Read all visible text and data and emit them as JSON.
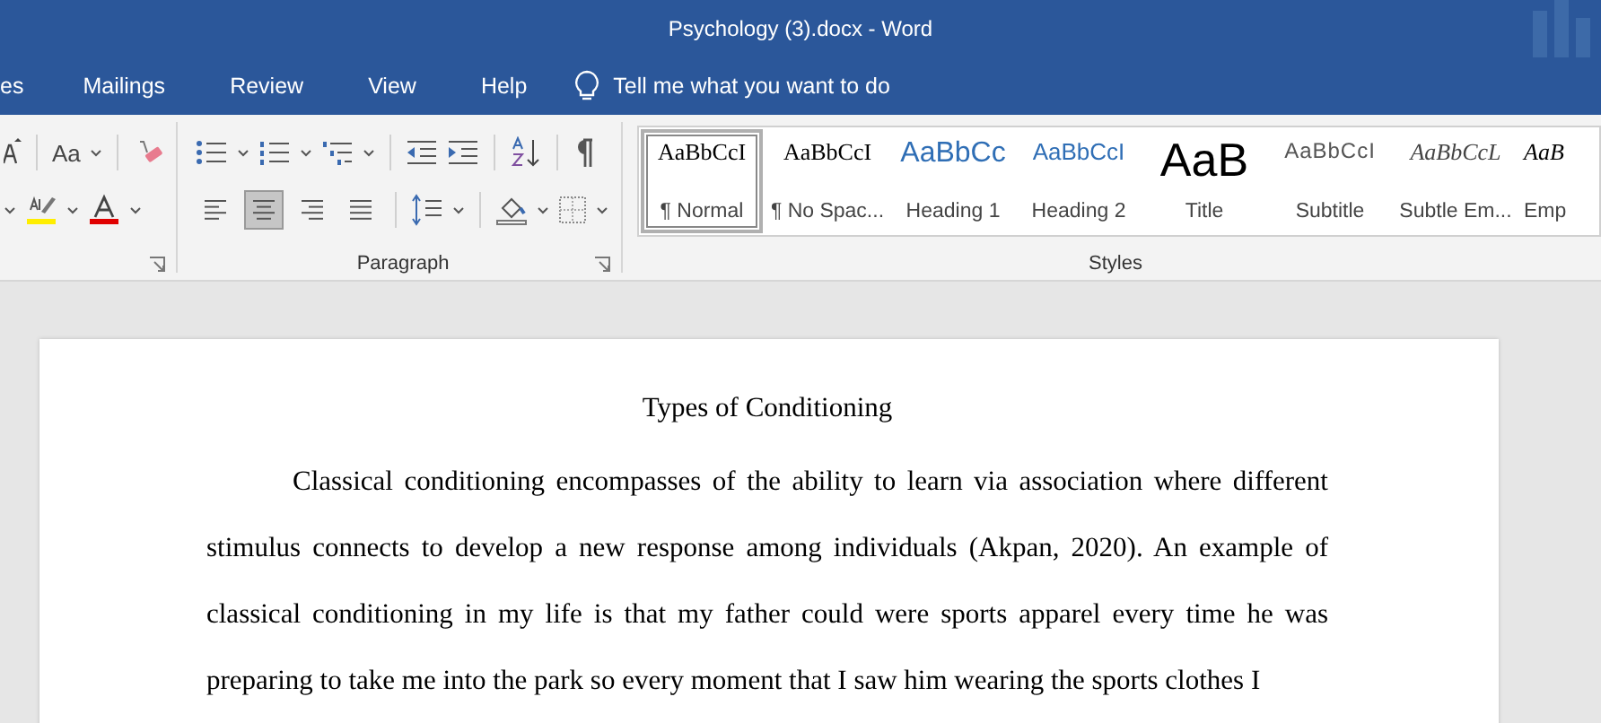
{
  "window": {
    "title": "Psychology (3).docx  -  Word"
  },
  "tabs": [
    {
      "label": "es"
    },
    {
      "label": "Mailings"
    },
    {
      "label": "Review"
    },
    {
      "label": "View"
    },
    {
      "label": "Help"
    }
  ],
  "tell_me": {
    "placeholder": "Tell me what you want to do"
  },
  "ribbon": {
    "font_group": {
      "change_case": "Aa"
    },
    "paragraph_group": {
      "label": "Paragraph",
      "alignment": [
        {
          "kind": "left",
          "selected": false
        },
        {
          "kind": "center",
          "selected": true
        },
        {
          "kind": "right",
          "selected": false
        },
        {
          "kind": "justify",
          "selected": false
        }
      ]
    },
    "styles_group": {
      "label": "Styles",
      "styles": [
        {
          "kind": "normal",
          "preview": "AaBbCcI",
          "label": "¶ Normal",
          "selected": true
        },
        {
          "kind": "nospace",
          "preview": "AaBbCcI",
          "label": "¶ No Spac...",
          "selected": false
        },
        {
          "kind": "heading1",
          "preview": "AaBbCc",
          "label": "Heading 1",
          "selected": false
        },
        {
          "kind": "heading2",
          "preview": "AaBbCcI",
          "label": "Heading 2",
          "selected": false
        },
        {
          "kind": "title",
          "preview": "AaB",
          "label": "Title",
          "selected": false
        },
        {
          "kind": "subtitle",
          "preview": "AaBbCcI",
          "label": "Subtitle",
          "selected": false
        },
        {
          "kind": "subtle",
          "preview": "AaBbCcL",
          "label": "Subtle Em...",
          "selected": false
        },
        {
          "kind": "emphasis",
          "preview": "AaB",
          "label": "Emp",
          "selected": false
        }
      ]
    }
  },
  "document": {
    "heading": "Types of Conditioning",
    "paragraph": "Classical conditioning encompasses of the ability to learn via association where different stimulus connects to develop a new response among individuals (Akpan, 2020). An example of classical conditioning in my life is that my father could were sports apparel every time he was preparing to take me into the park so every moment that I saw him wearing the sports clothes I"
  }
}
